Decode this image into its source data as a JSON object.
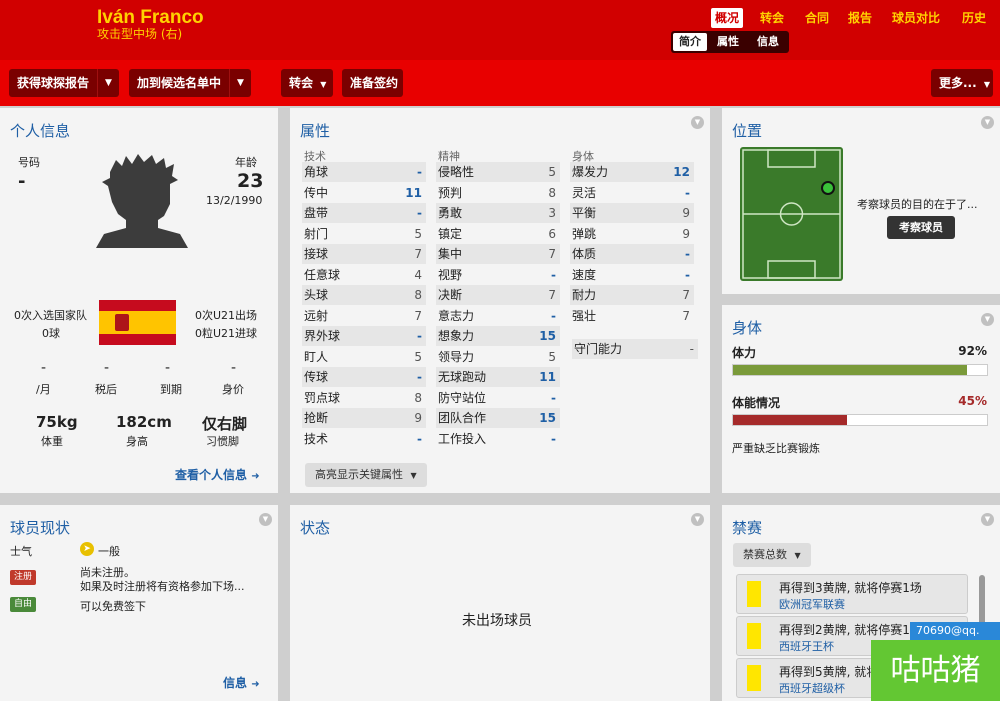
{
  "header": {
    "player_name": "Iván Franco",
    "player_position": "攻击型中场 (右)",
    "nav": [
      "概况",
      "转会",
      "合同",
      "报告",
      "球员对比",
      "历史"
    ],
    "subtabs": [
      "简介",
      "属性",
      "信息"
    ]
  },
  "toolbar": {
    "scout_report": "获得球探报告",
    "add_shortlist": "加到候选名单中",
    "transfer": "转会",
    "sign": "准备签约",
    "more": "更多..."
  },
  "personal": {
    "title": "个人信息",
    "number_label": "号码",
    "number_value": "-",
    "age_label": "年龄",
    "age_value": "23",
    "dob": "13/2/1990",
    "intl_caps": "0次入选国家队",
    "intl_goals": "0球",
    "u21_caps": "0次U21出场",
    "u21_goals": "0粒U21进球",
    "wage_value": "-",
    "wage_label": "/月",
    "aftertax_value": "-",
    "aftertax_label": "税后",
    "expiry_value": "-",
    "expiry_label": "到期",
    "worth_value": "-",
    "worth_label": "身价",
    "weight_value": "75kg",
    "weight_label": "体重",
    "height_value": "182cm",
    "height_label": "身高",
    "foot_value": "仅右脚",
    "foot_label": "习惯脚",
    "link": "查看个人信息"
  },
  "attributes": {
    "title": "属性",
    "technical_head": "技术",
    "mental_head": "精神",
    "physical_head": "身体",
    "technical": [
      {
        "name": "角球",
        "value": "-"
      },
      {
        "name": "传中",
        "value": "11"
      },
      {
        "name": "盘带",
        "value": "-"
      },
      {
        "name": "射门",
        "value": "5"
      },
      {
        "name": "接球",
        "value": "7"
      },
      {
        "name": "任意球",
        "value": "4"
      },
      {
        "name": "头球",
        "value": "8"
      },
      {
        "name": "远射",
        "value": "7"
      },
      {
        "name": "界外球",
        "value": "-"
      },
      {
        "name": "盯人",
        "value": "5"
      },
      {
        "name": "传球",
        "value": "-"
      },
      {
        "name": "罚点球",
        "value": "8"
      },
      {
        "name": "抢断",
        "value": "9"
      },
      {
        "name": "技术",
        "value": "-"
      }
    ],
    "mental": [
      {
        "name": "侵略性",
        "value": "5"
      },
      {
        "name": "预判",
        "value": "8"
      },
      {
        "name": "勇敢",
        "value": "3"
      },
      {
        "name": "镇定",
        "value": "6"
      },
      {
        "name": "集中",
        "value": "7"
      },
      {
        "name": "视野",
        "value": "-"
      },
      {
        "name": "决断",
        "value": "7"
      },
      {
        "name": "意志力",
        "value": "-"
      },
      {
        "name": "想象力",
        "value": "15"
      },
      {
        "name": "领导力",
        "value": "5"
      },
      {
        "name": "无球跑动",
        "value": "11"
      },
      {
        "name": "防守站位",
        "value": "-"
      },
      {
        "name": "团队合作",
        "value": "15"
      },
      {
        "name": "工作投入",
        "value": "-"
      }
    ],
    "physical": [
      {
        "name": "爆发力",
        "value": "12"
      },
      {
        "name": "灵活",
        "value": "-"
      },
      {
        "name": "平衡",
        "value": "9"
      },
      {
        "name": "弹跳",
        "value": "9"
      },
      {
        "name": "体质",
        "value": "-"
      },
      {
        "name": "速度",
        "value": "-"
      },
      {
        "name": "耐力",
        "value": "7"
      },
      {
        "name": "强壮",
        "value": "7"
      }
    ],
    "gk": {
      "name": "守门能力",
      "value": "-"
    },
    "highlight_btn": "高亮显示关键属性"
  },
  "position": {
    "title": "位置",
    "note": "考察球员的目的在于了...",
    "scout_btn": "考察球员"
  },
  "fitness": {
    "title": "身体",
    "condition_label": "体力",
    "condition_value": "92%",
    "condition_pct": 92,
    "sharpness_label": "体能情况",
    "sharpness_value": "45%",
    "sharpness_pct": 45,
    "note": "严重缺乏比赛锻炼",
    "condition_color": "#7a9a3a",
    "sharpness_color": "#a52a2a"
  },
  "status": {
    "title": "球员现状",
    "morale_label": "士气",
    "morale_value": "一般",
    "reg_tag": "注册",
    "reg_line1": "尚未注册。",
    "reg_line2": "如果及时注册将有资格参加下场...",
    "free_tag": "自由",
    "free_text": "可以免费签下",
    "link": "信息"
  },
  "form": {
    "title": "状态",
    "empty": "未出场球员"
  },
  "bans": {
    "title": "禁赛",
    "filter": "禁赛总数",
    "items": [
      {
        "title": "再得到3黄牌, 就将停赛1场",
        "comp": "欧洲冠军联赛"
      },
      {
        "title": "再得到2黄牌, 就将停赛1场",
        "comp": "西班牙王杯"
      },
      {
        "title": "再得到5黄牌, 就将停赛1场",
        "comp": "西班牙超级杯"
      }
    ]
  },
  "watermark": {
    "tooltip": "70690@qq.",
    "logo": "咕咕猪"
  }
}
